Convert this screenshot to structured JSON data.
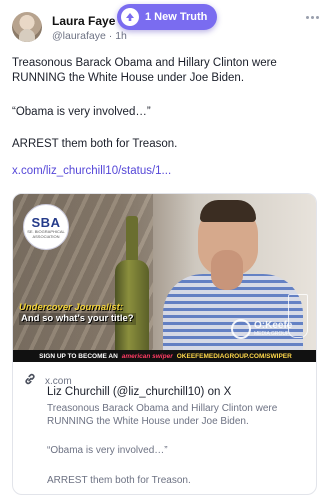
{
  "author": {
    "name": "Laura Faye",
    "handle": "@laurafaye",
    "time_separator": "·",
    "time": "1h"
  },
  "notification": {
    "label": "1 New Truth",
    "icon": "up-arrow-icon",
    "color": "#7a6cf0"
  },
  "post": {
    "paragraphs": [
      "Treasonous Barack Obama and Hillary Clinton were RUNNING the White House under Joe Biden.",
      "“Obama is very involved…”",
      "ARREST them both for Treason."
    ],
    "link": "x.com/liz_churchill10/status/1..."
  },
  "video": {
    "logo_text": "SBA",
    "logo_subtext": "SE. BIOGRAPHICAL ASSOCIATION",
    "caption_line1": "Undercover Journalist:",
    "caption_line2": "And so what's your title?",
    "watermark_main": "O:Keefe",
    "watermark_sub": "MEDIA GROUP",
    "banner_prefix": "SIGN UP TO BECOME AN",
    "banner_swiper": "american swiper",
    "banner_url": "OKEEFEMEDIAGROUP.COM/SWIPER"
  },
  "link_card": {
    "domain": "x.com",
    "icon": "link-icon",
    "title": "Liz Churchill (@liz_churchill10) on X",
    "description": [
      "Treasonous Barack Obama and Hillary Clinton were RUNNING the White House under Joe Biden.",
      "“Obama is very involved…”",
      "ARREST them both for Treason."
    ]
  },
  "colors": {
    "accent": "#5547d8",
    "text": "#1b1f2a",
    "muted": "#6d7283"
  }
}
